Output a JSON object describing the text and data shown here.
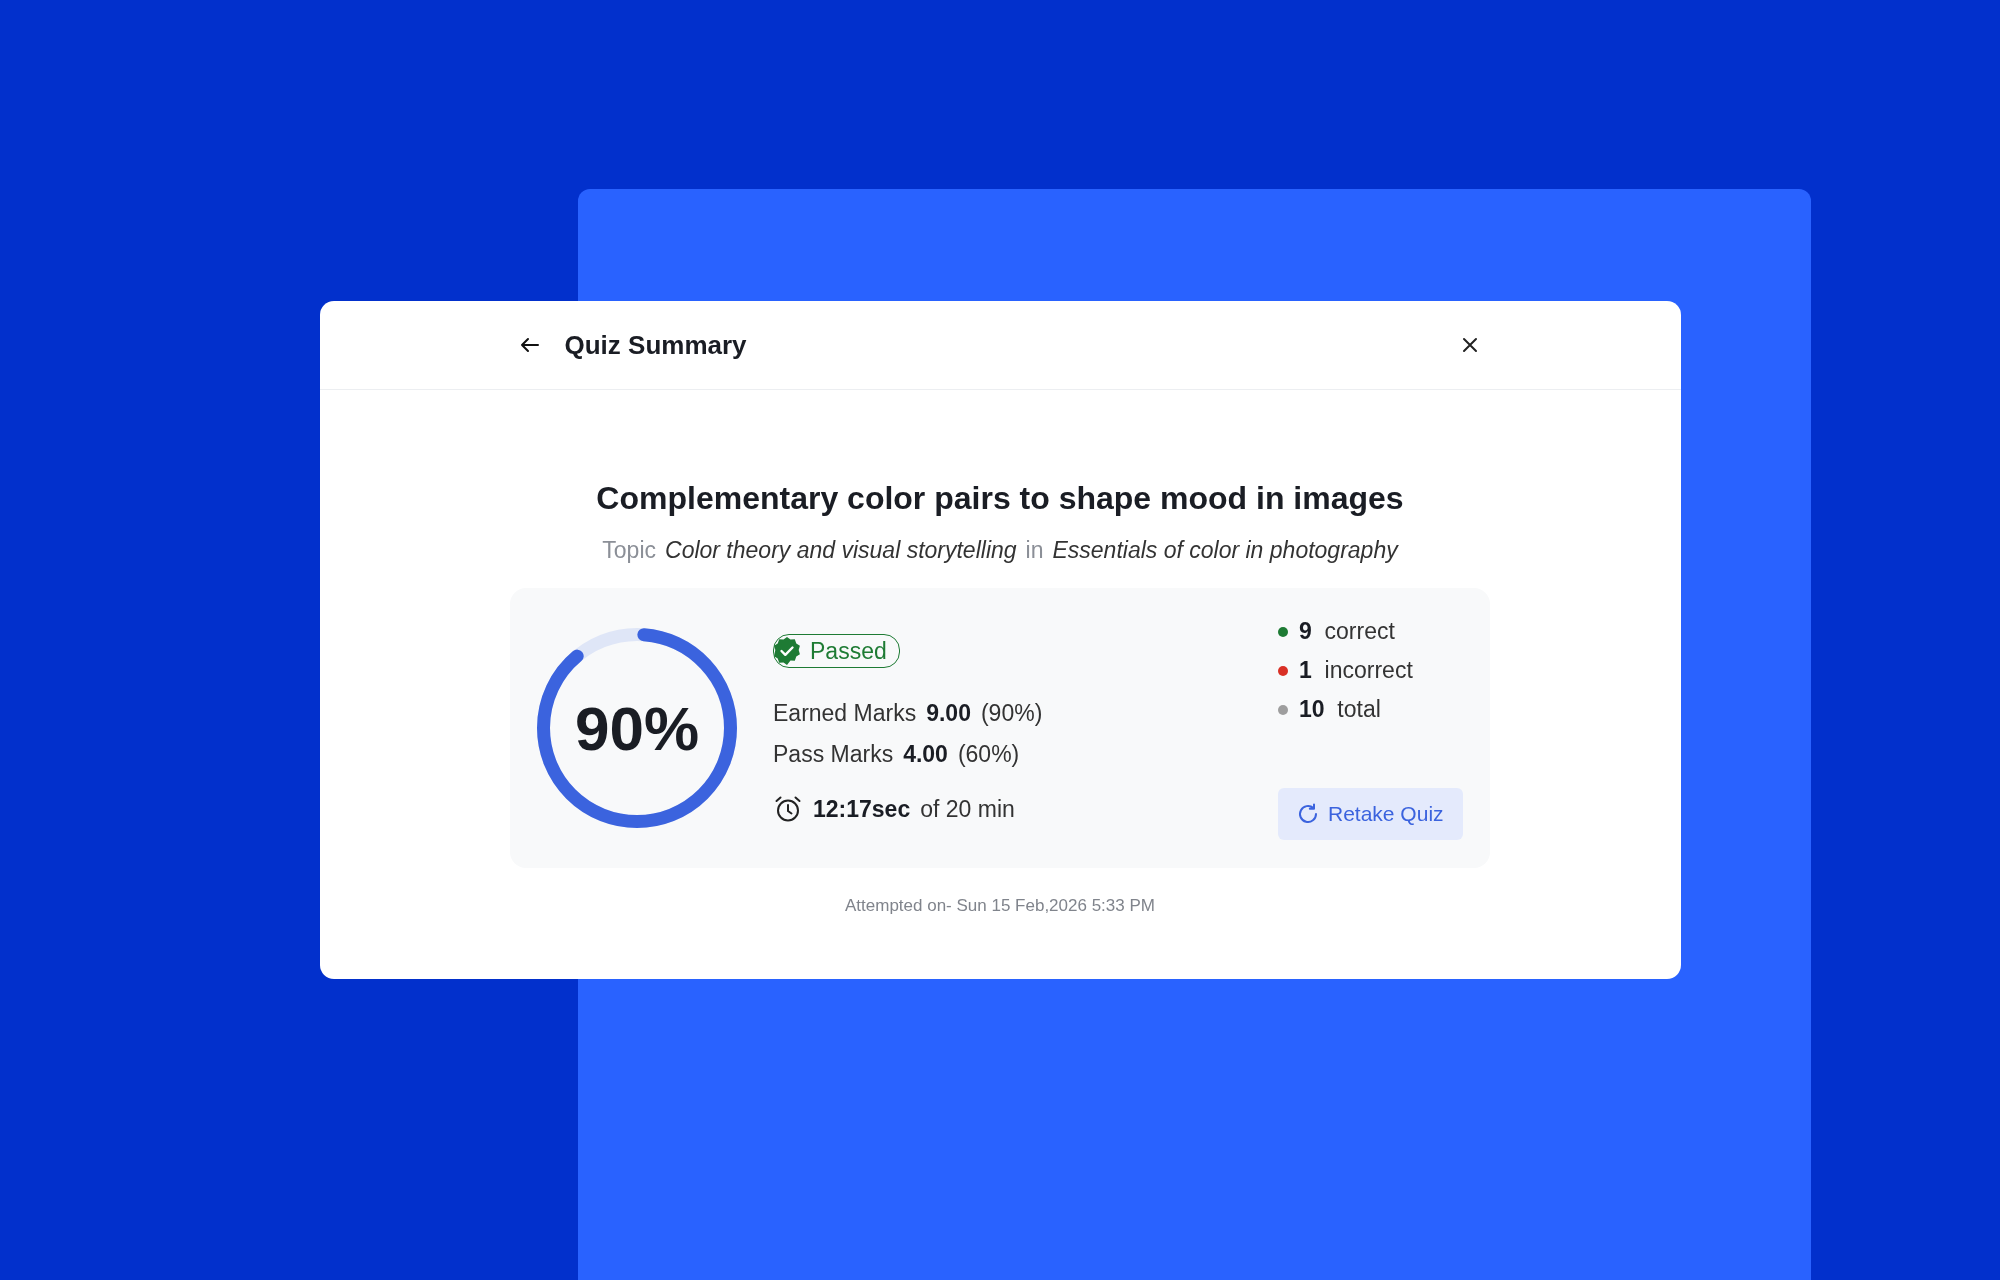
{
  "header": {
    "title": "Quiz Summary"
  },
  "quiz": {
    "title": "Complementary color pairs to shape mood in images",
    "topic_label": "Topic",
    "topic": "Color theory and visual storytelling",
    "in_label": "in",
    "course": "Essentials of color in photography"
  },
  "result": {
    "percent": "90%",
    "status": "Passed",
    "passed": true,
    "marks": [
      {
        "label": "Earned Marks",
        "value": "9.00",
        "percent": "(90%)"
      },
      {
        "label": "Pass Marks",
        "value": "4.00",
        "percent": "(60%)"
      }
    ],
    "time": {
      "value": "12:17sec",
      "limit": "of 20 min"
    },
    "counts": [
      {
        "number": "9",
        "unit": "correct",
        "color": "#1e7b34"
      },
      {
        "number": "1",
        "unit": "incorrect",
        "color": "#d93025"
      },
      {
        "number": "10",
        "unit": "total",
        "color": "#9e9e9e"
      }
    ],
    "retake_button": "Retake Quiz"
  },
  "attempted": "Attempted on- Sun 15 Feb,2026 5:33 PM"
}
